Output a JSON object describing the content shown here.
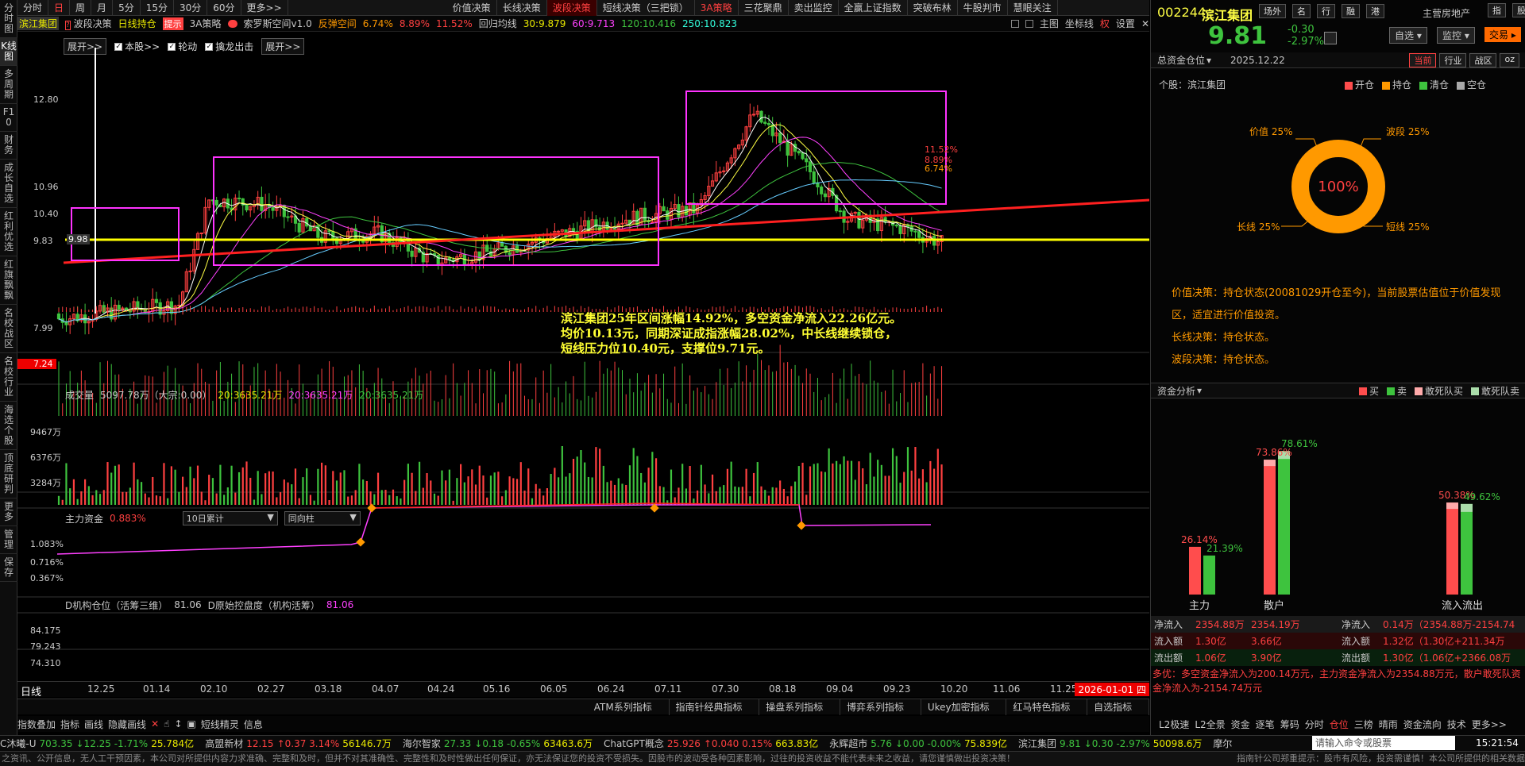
{
  "left_nav": [
    "分时图",
    "K线图",
    "多周期",
    "F10",
    "财务",
    "成长自选",
    "红利优选",
    "红旗飘飘",
    "名校战区",
    "名校行业",
    "海选个股",
    "顶底研判",
    "更多",
    "管理",
    "保存"
  ],
  "period_tabs": [
    "分时",
    "日",
    "周",
    "月",
    "5分",
    "15分",
    "30分",
    "60分",
    "更多>>"
  ],
  "strategy_tabs": [
    "价值决策",
    "长线决策",
    "波段决策",
    "短线决策（三把锁）",
    "3A策略",
    "三花聚鼎",
    "卖出监控",
    "全赢上证指数",
    "突破布林",
    "牛股判市",
    "慧眼关注"
  ],
  "title_bar": {
    "stock": "滨江集团",
    "wave": "波段决策",
    "daily": "日线持仓",
    "hint": "提示",
    "strategy3a": "3A策略",
    "space": "索罗斯空间v1.0",
    "rebound": "反弹空间",
    "rebound_vals": [
      "6.74%",
      "8.89%",
      "11.52%"
    ],
    "ma_label": "回归均线",
    "ma30": "30:9.879",
    "ma60": "60:9.713",
    "ma120": "120:10.416",
    "ma250": "250:10.823",
    "main_btn": "主图",
    "coord": "坐标线",
    "quan": "权",
    "settings": "设置"
  },
  "checks": {
    "expand1": "展开>>",
    "benstock": "本股>>",
    "lunndong": "轮动",
    "qinlong": "擒龙出击",
    "expand2": "展开>>"
  },
  "price_axis": [
    "12.80",
    "10.96",
    "10.40",
    "9.83",
    "7.99",
    "7.24"
  ],
  "price_line_label": "9.98",
  "annotation": [
    "滨江集团25年区间涨幅14.92%，多空资金净流入22.26亿元。",
    "均价10.13元，同期深证成指涨幅28.02%，中长线继续锁仓，",
    "短线压力位10.40元，支撑位9.71元。"
  ],
  "right_pct_labels": [
    "11.52%",
    "8.89%",
    "6.74%"
  ],
  "volume_panel": {
    "label": "成交量",
    "v1": "5097.78万（大宗:0.00）",
    "v2": "20:3635.21万",
    "v3": "20:3635.21万",
    "v4": "20:3635.21万",
    "axis": [
      "9467万",
      "6376万",
      "3284万"
    ]
  },
  "fund_panel": {
    "label": "主力资金",
    "value": "0.883%",
    "dd1": "10日累计",
    "dd2": "同向柱",
    "axis": [
      "1.083%",
      "0.716%",
      "0.367%"
    ]
  },
  "inst_panel": {
    "label": "D机构仓位（活筹三维）",
    "value": "81.06",
    "label2": "D原始控盘度（机构活筹）",
    "value2": "81.06",
    "axis": [
      "84.175",
      "79.243",
      "74.310"
    ]
  },
  "date_axis": {
    "label": "日线",
    "dates": [
      "12.25",
      "01.14",
      "02.10",
      "02.27",
      "03.18",
      "04.07",
      "04.24",
      "05.16",
      "06.05",
      "06.24",
      "07.11",
      "07.30",
      "08.18",
      "09.04",
      "09.23",
      "10.20",
      "11.06",
      "11.25"
    ],
    "current": "2026-01-01 四"
  },
  "bottom_tabs": [
    "ATM系列指标 ▲",
    "指南针经典指标 ▲",
    "操盘系列指标 ▲",
    "博弈系列指标 ▲",
    "Ukey加密指标 ▲",
    "红马特色指标 ▲",
    "自选指标 ▲"
  ],
  "toolbar": [
    "指数叠加",
    "指标",
    "画线",
    "隐藏画线",
    "短线精灵",
    "信息"
  ],
  "stock_header": {
    "code": "002244",
    "name": "滨江集团",
    "place": "场外",
    "buttons": [
      "名",
      "行",
      "融",
      "港"
    ],
    "sector": "主营房地产",
    "right_btns": [
      "指",
      "股"
    ],
    "price": "9.81",
    "change": "-0.30",
    "pct": "-2.97%",
    "zixuan": "自选",
    "jiankong": "监控",
    "jiaoyi": "交易"
  },
  "position": {
    "title": "总资金仓位",
    "date": "2025.12.22",
    "tabs": [
      "当前",
      "行业",
      "战区",
      "oz"
    ],
    "subject": "个股：滨江集团",
    "legend": [
      "开仓",
      "持仓",
      "清仓",
      "空仓"
    ],
    "center": "100%",
    "labels": [
      "价值 25%",
      "波段 25%",
      "长线 25%",
      "短线 25%"
    ]
  },
  "decisions": [
    {
      "k": "价值决策：",
      "v": "持仓状态",
      "rest": "(20081029开仓至今)，当前股票估值位于价值发现区，适宜进行价值投资。"
    },
    {
      "k": "长线决策：",
      "v": "持仓状态。"
    },
    {
      "k": "波段决策：",
      "v": "持仓状态。"
    }
  ],
  "fund_analysis": {
    "title": "资金分析",
    "legend": [
      "买",
      "卖",
      "敢死队买",
      "敢死队卖"
    ],
    "bars": [
      {
        "cat": "主力",
        "buy": 26.14,
        "sell": 21.39
      },
      {
        "cat": "散户",
        "buy": 73.86,
        "sell": 78.61
      },
      {
        "cat": "流入流出",
        "buy": 50.38,
        "sell": 49.62
      }
    ],
    "labels": [
      "26.14%",
      "21.39%",
      "73.86%",
      "78.61%",
      "50.38%",
      "49.62%"
    ]
  },
  "flow_table": [
    {
      "k": "净流入",
      "a": "2354.88万",
      "b": "2354.19万",
      "k2": "净流入",
      "c": "0.14万（2354.88万-2154.74"
    },
    {
      "k": "流入额",
      "a": "1.30亿",
      "b": "3.66亿",
      "k2": "流入额",
      "c": "1.32亿（1.30亿+211.34万"
    },
    {
      "k": "流出额",
      "a": "1.06亿",
      "b": "3.90亿",
      "k2": "流出额",
      "c": "1.30亿（1.06亿+2366.08万"
    }
  ],
  "advice": "多优：多空资金净流入为200.14万元，主力资金净流入为2354.88万元，散户敢死队资金净流入为-2154.74万元",
  "right_bottom_tabs": [
    "L2极速",
    "L2全景",
    "资金",
    "逐笔",
    "筹码",
    "分时",
    "仓位",
    "三榜",
    "晴雨",
    "资金流向",
    "技术",
    "更多>>"
  ],
  "ticker": [
    {
      "n": "C沐曦-U",
      "p": "703.35",
      "c": "↓12.25 -1.71%",
      "v": "25.784亿",
      "d": "dn"
    },
    {
      "n": "高盟新材",
      "p": "12.15",
      "c": "↑0.37 3.14%",
      "v": "56146.7万",
      "d": "up"
    },
    {
      "n": "海尔智家",
      "p": "27.33",
      "c": "↓0.18 -0.65%",
      "v": "63463.6万",
      "d": "dn"
    },
    {
      "n": "ChatGPT概念",
      "p": "25.926",
      "c": "↑0.040 0.15%",
      "v": "663.83亿",
      "d": "up"
    },
    {
      "n": "永辉超市",
      "p": "5.76",
      "c": "↓0.00 -0.00%",
      "v": "75.839亿",
      "d": "dn"
    },
    {
      "n": "滨江集团",
      "p": "9.81",
      "c": "↓0.30 -2.97%",
      "v": "50098.6万",
      "d": "dn"
    },
    {
      "n": "摩尔",
      "p": "",
      "c": "",
      "v": "",
      "d": "up"
    }
  ],
  "search_placeholder": "请输入命令或股票",
  "clock": "15:21:54",
  "disclaimer": "之资讯、公开信息，无人工干预因素，本公司对所提供内容力求准确、完整和及时，但并不对其准确性、完整性和及时性做出任何保证，亦无法保证您的投资不受损失。因股市的波动受各种因素影响，过往的投资收益不能代表未来之收益，请您谨慎做出投资决策！",
  "disclaimer_right": "指南针公司郑重提示：股市有风险，投资需谨慎！本公司所提供的相关数据"
}
